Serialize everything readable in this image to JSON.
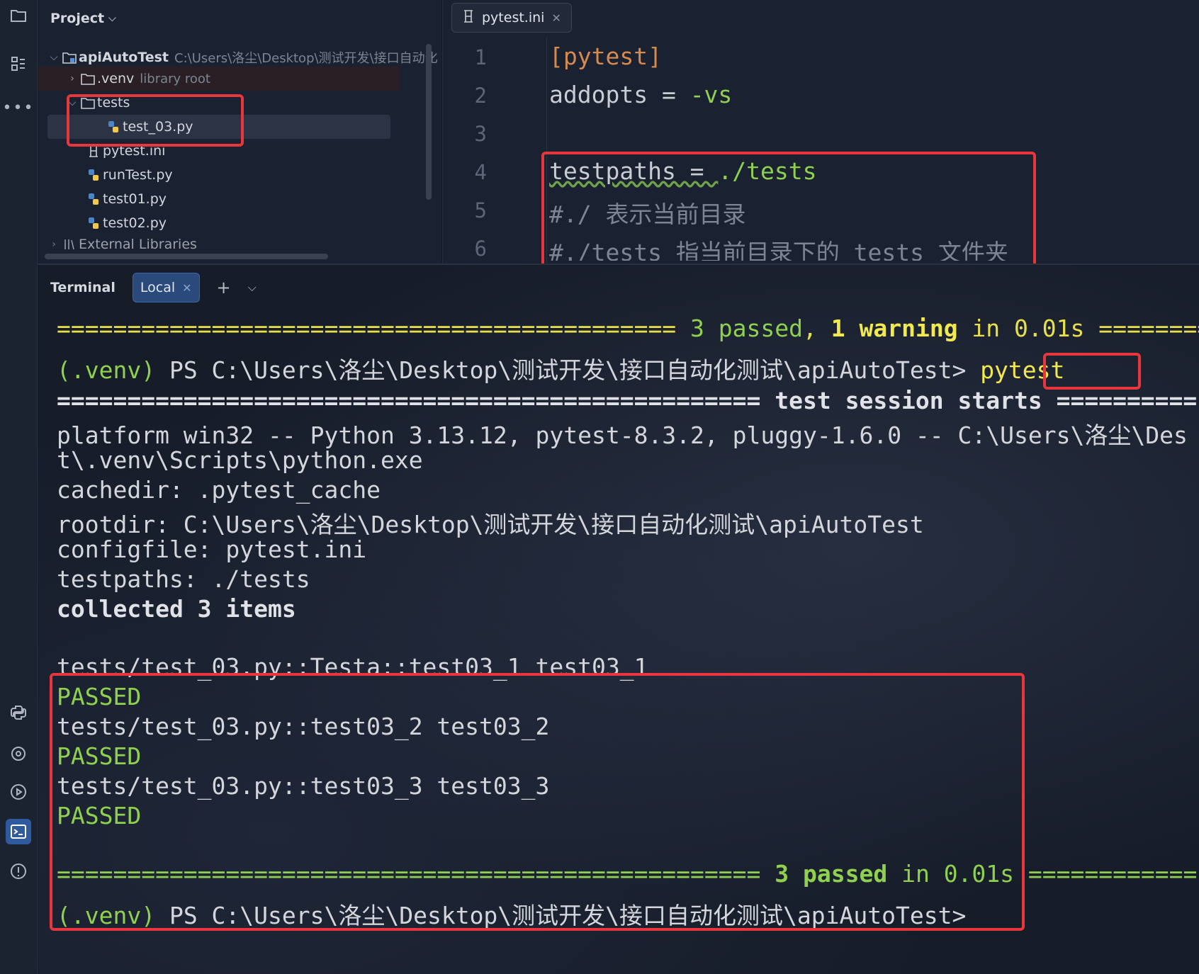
{
  "project": {
    "header": "Project",
    "root": {
      "name": "apiAutoTest",
      "path": "C:\\Users\\洛尘\\Desktop\\测试开发\\接口自动化"
    },
    "venv": {
      "name": ".venv",
      "note": "library root"
    },
    "tests_folder": "tests",
    "test_03": "test_03.py",
    "files": [
      "pytest.ini",
      "runTest.py",
      "test01.py",
      "test02.py"
    ],
    "external": "External Libraries"
  },
  "editor": {
    "tab_label": "pytest.ini",
    "line_numbers": [
      "1",
      "2",
      "3",
      "4",
      "5",
      "6"
    ],
    "lines": {
      "l1": "[pytest]",
      "l2_key": "addopts = ",
      "l2_val": "-vs",
      "l4_key": "testpaths = ",
      "l4_val": "./tests",
      "l5": "#./ 表示当前目录",
      "l6": "#./tests 指当前目录下的 tests 文件夹"
    }
  },
  "terminal": {
    "title": "Terminal",
    "tab": "Local",
    "summary_prev": {
      "bar_left": "============================================ ",
      "passed": "3 passed",
      "comma": ", ",
      "warning": "1 warning",
      "rest": " in 0.01s ========"
    },
    "prompt_venv": "(.venv)",
    "prompt_path": " PS C:\\Users\\洛尘\\Desktop\\测试开发\\接口自动化测试\\apiAutoTest> ",
    "command": "pytest",
    "session_bar": "================================================== test session starts ==========",
    "platform": "platform win32 -- Python 3.13.12, pytest-8.3.2, pluggy-1.6.0 -- C:\\Users\\洛尘\\Des",
    "platform_cont": "t\\.venv\\Scripts\\python.exe",
    "cachedir": "cachedir: .pytest_cache",
    "rootdir": "rootdir: C:\\Users\\洛尘\\Desktop\\测试开发\\接口自动化测试\\apiAutoTest",
    "configfile": "configfile: pytest.ini",
    "testpaths": "testpaths: ./tests",
    "collected": "collected 3 items",
    "results": [
      {
        "test": "tests/test_03.py::Testa::test03_1 test03_1",
        "status": "PASSED"
      },
      {
        "test": "tests/test_03.py::test03_2 test03_2",
        "status": "PASSED"
      },
      {
        "test": "tests/test_03.py::test03_3 test03_3",
        "status": "PASSED"
      }
    ],
    "final_bar_left": "================================================== ",
    "final_passed": "3 passed",
    "final_rest": " in 0.01s",
    "final_bar_right": " ============"
  },
  "colors": {
    "red_box": "#e8363d",
    "green": "#8fd14f",
    "yellow": "#f2e94e",
    "accent": "#2f5a9e"
  }
}
